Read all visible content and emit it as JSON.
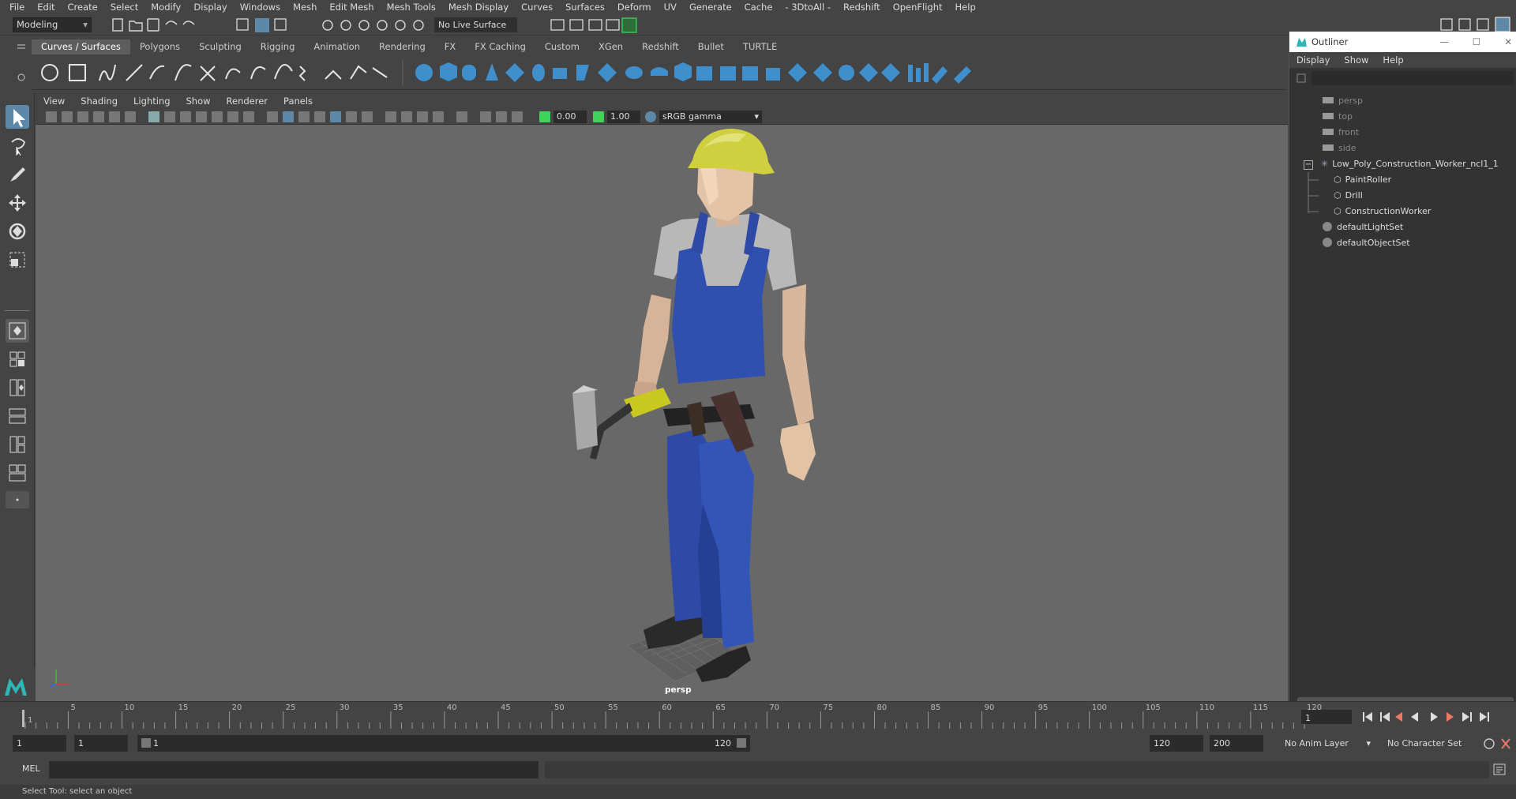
{
  "menubar": {
    "items": [
      "File",
      "Edit",
      "Create",
      "Select",
      "Modify",
      "Display",
      "Windows",
      "Mesh",
      "Edit Mesh",
      "Mesh Tools",
      "Mesh Display",
      "Curves",
      "Surfaces",
      "Deform",
      "UV",
      "Generate",
      "Cache",
      "- 3DtoAll -",
      "Redshift",
      "OpenFlight",
      "Help"
    ]
  },
  "statusline": {
    "mode": "Modeling",
    "live_surface": "No Live Surface"
  },
  "shelf": {
    "tabs": [
      "Curves / Surfaces",
      "Polygons",
      "Sculpting",
      "Rigging",
      "Animation",
      "Rendering",
      "FX",
      "FX Caching",
      "Custom",
      "XGen",
      "Redshift",
      "Bullet",
      "TURTLE"
    ],
    "active_tab": "Curves / Surfaces"
  },
  "panel": {
    "menu": [
      "View",
      "Shading",
      "Lighting",
      "Show",
      "Renderer",
      "Panels"
    ],
    "exposure": "0.00",
    "gamma": "1.00",
    "colorspace": "sRGB gamma",
    "camera_label": "persp"
  },
  "outliner": {
    "title": "Outliner",
    "menu": [
      "Display",
      "Show",
      "Help"
    ],
    "items": [
      {
        "label": "persp",
        "icon": "camera-icon",
        "dim": true
      },
      {
        "label": "top",
        "icon": "camera-icon",
        "dim": true
      },
      {
        "label": "front",
        "icon": "camera-icon",
        "dim": true
      },
      {
        "label": "side",
        "icon": "camera-icon",
        "dim": true
      },
      {
        "label": "Low_Poly_Construction_Worker_ncl1_1",
        "icon": "group-icon",
        "dim": false
      },
      {
        "label": "PaintRoller",
        "icon": "mesh-icon",
        "dim": false
      },
      {
        "label": "Drill",
        "icon": "mesh-icon",
        "dim": false
      },
      {
        "label": "ConstructionWorker",
        "icon": "mesh-icon",
        "dim": false
      },
      {
        "label": "defaultLightSet",
        "icon": "set-icon",
        "dim": false
      },
      {
        "label": "defaultObjectSet",
        "icon": "set-icon",
        "dim": false
      }
    ]
  },
  "timeline": {
    "ticks": [
      "1",
      "5",
      "10",
      "15",
      "20",
      "25",
      "30",
      "35",
      "40",
      "45",
      "50",
      "55",
      "60",
      "65",
      "70",
      "75",
      "80",
      "85",
      "90",
      "95",
      "100",
      "105",
      "110",
      "115",
      "120"
    ],
    "current_frame": "1"
  },
  "range": {
    "start": "1",
    "anim_start": "1",
    "slider_start": "1",
    "slider_end": "120",
    "end": "120",
    "anim_end": "200",
    "anim_layer": "No Anim Layer",
    "character_set": "No Character Set"
  },
  "cmdline": {
    "label": "MEL"
  },
  "helpline": {
    "text": "Select Tool: select an object"
  },
  "colors": {
    "accent": "#5e88a8",
    "viewport_bg": "#686868",
    "worker_blue": "#2e49a6"
  }
}
